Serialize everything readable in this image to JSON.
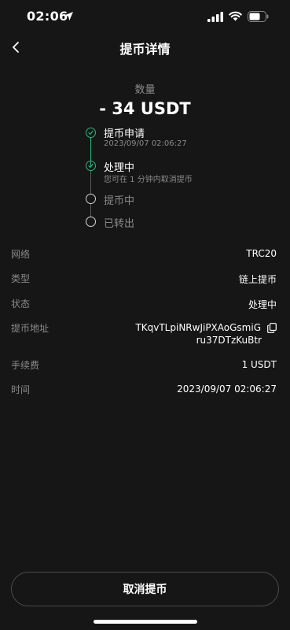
{
  "status_bar": {
    "time": "02:06"
  },
  "nav": {
    "title": "提币详情"
  },
  "amount": {
    "label": "数量",
    "value": "- 34 USDT"
  },
  "timeline": [
    {
      "title": "提币申请",
      "subtitle": "2023/09/07 02:06:27",
      "state": "done"
    },
    {
      "title": "处理中",
      "subtitle": "您可在 1 分钟内取消提币",
      "state": "done"
    },
    {
      "title": "提币中",
      "subtitle": "",
      "state": "pending"
    },
    {
      "title": "已转出",
      "subtitle": "",
      "state": "pending"
    }
  ],
  "details": {
    "network": {
      "label": "网络",
      "value": "TRC20"
    },
    "type": {
      "label": "类型",
      "value": "链上提币"
    },
    "status": {
      "label": "状态",
      "value": "处理中"
    },
    "address": {
      "label": "提币地址",
      "line1": "TKqvTLpiNRwJiPXAoGsmiG",
      "line2": "ru37DTzKuBtr"
    },
    "fee": {
      "label": "手续费",
      "value": "1 USDT"
    },
    "time": {
      "label": "时间",
      "value": "2023/09/07 02:06:27"
    }
  },
  "actions": {
    "cancel_label": "取消提币"
  },
  "colors": {
    "background": "#161616",
    "success": "#25b97d",
    "muted": "#8a8a8a"
  },
  "icons": [
    "location-arrow-icon",
    "signal-icon",
    "wifi-icon",
    "battery-icon",
    "back-chevron-icon",
    "check-icon",
    "copy-icon"
  ]
}
